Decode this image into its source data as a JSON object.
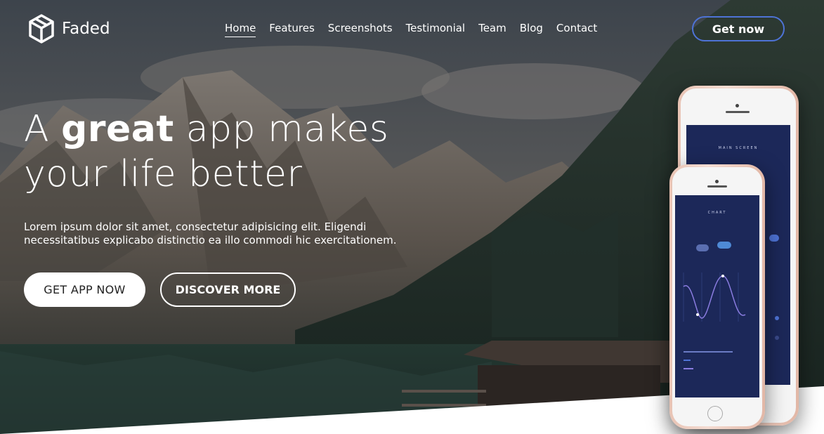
{
  "brand": {
    "name": "Faded",
    "logo_icon": "cube-logo-icon"
  },
  "nav": {
    "items": [
      {
        "label": "Home",
        "active": true
      },
      {
        "label": "Features",
        "active": false
      },
      {
        "label": "Screenshots",
        "active": false
      },
      {
        "label": "Testimonial",
        "active": false
      },
      {
        "label": "Team",
        "active": false
      },
      {
        "label": "Blog",
        "active": false
      },
      {
        "label": "Contact",
        "active": false
      }
    ],
    "cta_label": "Get now"
  },
  "hero": {
    "headline_pre": "A ",
    "headline_bold": "great",
    "headline_post": " app makes",
    "headline_line2": "your life better",
    "description": "Lorem ipsum dolor sit amet, consectetur adipisicing elit. Eligendi necessitatibus explicabo distinctio ea illo commodi hic exercitationem.",
    "primary_button": "GET APP NOW",
    "secondary_button": "DISCOVER MORE"
  },
  "phones": {
    "back_screen_title": "MAIN SCREEN",
    "front_screen_title": "CHART"
  },
  "colors": {
    "accent": "#4e73d6",
    "screen_bg": "#1c2859",
    "phone_body": "#f5f5f5",
    "phone_frame": "#e8c3b4"
  }
}
